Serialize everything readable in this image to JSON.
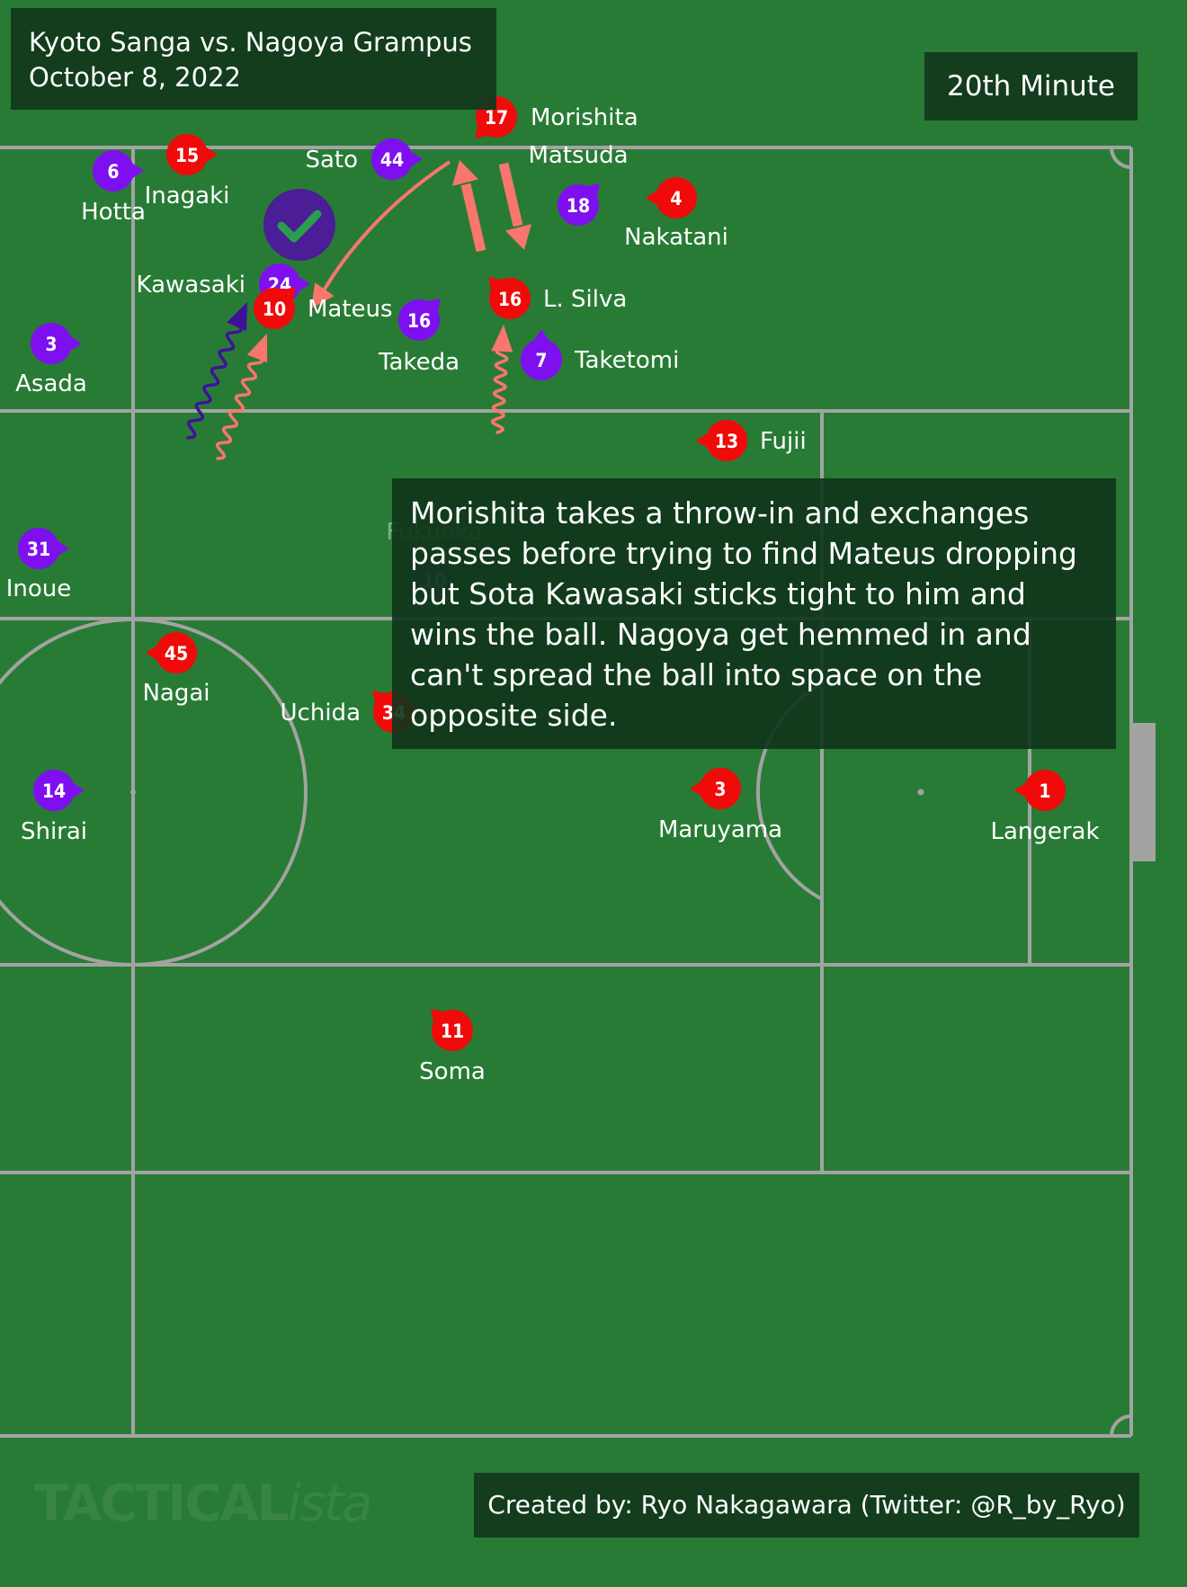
{
  "header": {
    "match": "Kyoto Sanga vs. Nagoya Grampus",
    "date": "October 8, 2022",
    "minute": "20th Minute"
  },
  "caption": "Morishita takes a throw-in and exchanges passes before trying to find Mateus dropping but Sota Kawasaki sticks tight to him and wins the ball. Nagoya get hemmed in and can't spread the ball into space on the opposite side.",
  "credit": "Created by: Ryo Nakagawara (Twitter: @R_by_Ryo)",
  "watermark": {
    "main": "TACTICAL",
    "suffix": "ista"
  },
  "colors": {
    "pitch": "#287b35",
    "lines": "#a3a3a3",
    "kyoto": "#7e10ef",
    "nagoya": "#f00a0a",
    "pass_arrow": "#f8766d",
    "run_kyoto": "#3f119b",
    "win_marker": "#4b1d96",
    "panel": "#123a1c"
  },
  "win_marker_icon": "check-circle-icon",
  "teams": {
    "kyoto": "Kyoto Sanga",
    "nagoya": "Nagoya Grampus"
  },
  "players": [
    {
      "id": "kyoto-6",
      "team": "kyoto",
      "number": "6",
      "name": "Hotta"
    },
    {
      "id": "nagoya-15",
      "team": "nagoya",
      "number": "15",
      "name": "Inagaki"
    },
    {
      "id": "kyoto-44",
      "team": "kyoto",
      "number": "44",
      "name": "Sato"
    },
    {
      "id": "nagoya-17",
      "team": "nagoya",
      "number": "17",
      "name": "Morishita"
    },
    {
      "id": "kyoto-18",
      "team": "kyoto",
      "number": "18",
      "name": "Matsuda"
    },
    {
      "id": "nagoya-4",
      "team": "nagoya",
      "number": "4",
      "name": "Nakatani"
    },
    {
      "id": "kyoto-24",
      "team": "kyoto",
      "number": "24",
      "name": "Kawasaki"
    },
    {
      "id": "nagoya-10",
      "team": "nagoya",
      "number": "10",
      "name": "Mateus"
    },
    {
      "id": "kyoto-16",
      "team": "kyoto",
      "number": "16",
      "name": "Takeda"
    },
    {
      "id": "nagoya-16",
      "team": "nagoya",
      "number": "16",
      "name": "L. Silva"
    },
    {
      "id": "kyoto-7",
      "team": "kyoto",
      "number": "7",
      "name": "Taketomi"
    },
    {
      "id": "kyoto-3",
      "team": "kyoto",
      "number": "3",
      "name": "Asada"
    },
    {
      "id": "nagoya-13",
      "team": "nagoya",
      "number": "13",
      "name": "Fujii"
    },
    {
      "id": "kyoto-31",
      "team": "kyoto",
      "number": "31",
      "name": "Inoue"
    },
    {
      "id": "kyoto-10",
      "team": "kyoto",
      "number": "10",
      "name": "Fukuoka"
    },
    {
      "id": "nagoya-45",
      "team": "nagoya",
      "number": "45",
      "name": "Nagai"
    },
    {
      "id": "nagoya-34",
      "team": "nagoya",
      "number": "34",
      "name": "Uchida"
    },
    {
      "id": "kyoto-14",
      "team": "kyoto",
      "number": "14",
      "name": "Shirai"
    },
    {
      "id": "nagoya-3",
      "team": "nagoya",
      "number": "3",
      "name": "Maruyama"
    },
    {
      "id": "nagoya-1",
      "team": "nagoya",
      "number": "1",
      "name": "Langerak"
    },
    {
      "id": "nagoya-11",
      "team": "nagoya",
      "number": "11",
      "name": "Soma"
    }
  ]
}
